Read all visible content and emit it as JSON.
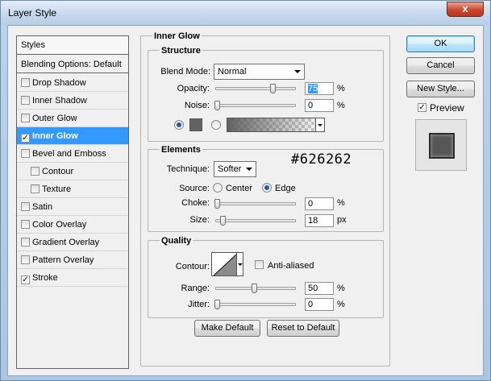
{
  "window": {
    "title": "Layer Style",
    "close_glyph": "x"
  },
  "styles_list": {
    "header": "Styles",
    "blending": "Blending Options: Default",
    "items": [
      {
        "label": "Drop Shadow",
        "checked": false
      },
      {
        "label": "Inner Shadow",
        "checked": false
      },
      {
        "label": "Outer Glow",
        "checked": false
      },
      {
        "label": "Inner Glow",
        "checked": true,
        "selected": true
      },
      {
        "label": "Bevel and Emboss",
        "checked": false
      },
      {
        "label": "Contour",
        "checked": false
      },
      {
        "label": "Texture",
        "checked": false
      },
      {
        "label": "Satin",
        "checked": false
      },
      {
        "label": "Color Overlay",
        "checked": false
      },
      {
        "label": "Gradient Overlay",
        "checked": false
      },
      {
        "label": "Pattern Overlay",
        "checked": false
      },
      {
        "label": "Stroke",
        "checked": true
      }
    ],
    "check_glyph": "✓"
  },
  "panel": {
    "title": "Inner Glow",
    "structure": {
      "title": "Structure",
      "blend_mode_label": "Blend Mode:",
      "blend_mode_value": "Normal",
      "opacity_label": "Opacity:",
      "opacity_value": "75",
      "opacity_unit": "%",
      "opacity_fraction": 0.75,
      "noise_label": "Noise:",
      "noise_value": "0",
      "noise_unit": "%",
      "noise_fraction": 0,
      "glow_color": "#626262",
      "fill_mode": "color"
    },
    "elements": {
      "title": "Elements",
      "technique_label": "Technique:",
      "technique_value": "Softer",
      "source_label": "Source:",
      "source_center": "Center",
      "source_edge": "Edge",
      "source_selected": "Edge",
      "choke_label": "Choke:",
      "choke_value": "0",
      "choke_unit": "%",
      "choke_fraction": 0,
      "size_label": "Size:",
      "size_value": "18",
      "size_unit": "px",
      "size_fraction": 0.072,
      "annotation": "#626262"
    },
    "quality": {
      "title": "Quality",
      "contour_label": "Contour:",
      "anti_aliased_label": "Anti-aliased",
      "anti_aliased": false,
      "range_label": "Range:",
      "range_value": "50",
      "range_unit": "%",
      "range_fraction": 0.5,
      "jitter_label": "Jitter:",
      "jitter_value": "0",
      "jitter_unit": "%",
      "jitter_fraction": 0
    },
    "make_default": "Make Default",
    "reset_to_default": "Reset to Default"
  },
  "buttons": {
    "ok": "OK",
    "cancel": "Cancel",
    "new_style": "New Style..."
  },
  "preview": {
    "label": "Preview",
    "checked": true
  }
}
